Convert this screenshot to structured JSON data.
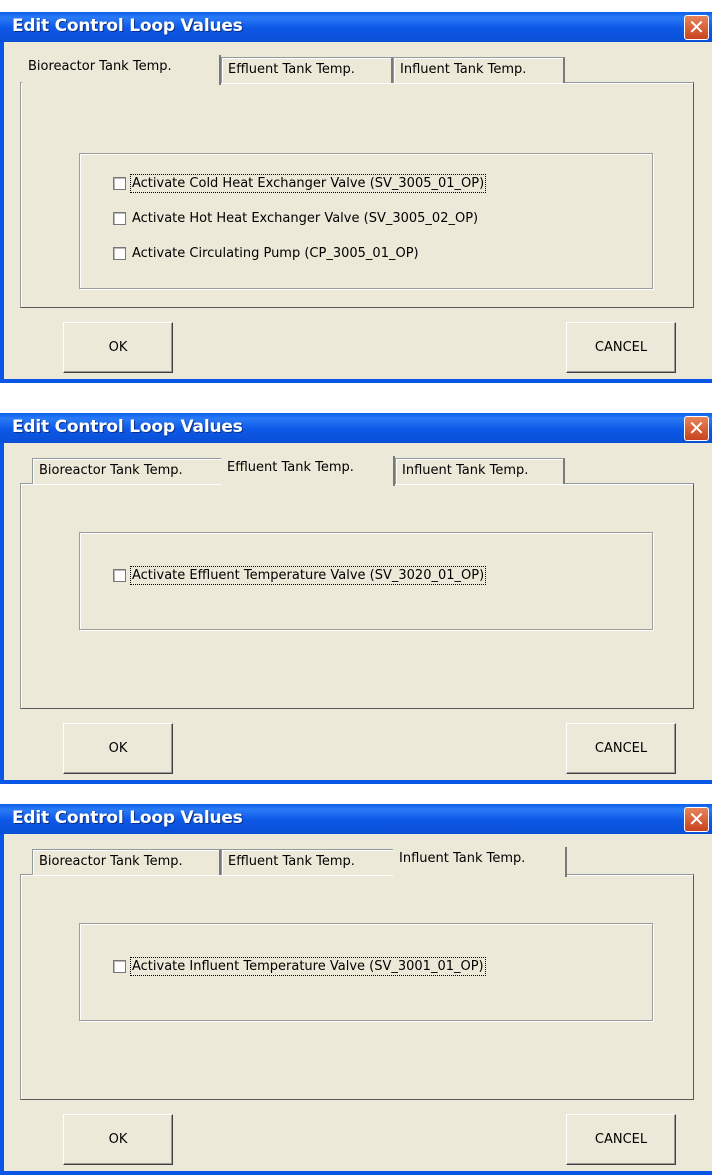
{
  "dialogs": [
    {
      "title": "Edit Control Loop Values",
      "close_glyph": "✕",
      "tabs": [
        "Bioreactor Tank Temp.",
        "Effluent Tank Temp.",
        "Influent Tank Temp."
      ],
      "active_tab": 0,
      "checkboxes": [
        {
          "label": "Activate Cold Heat Exchanger Valve (SV_3005_01_OP)",
          "checked": false
        },
        {
          "label": "Activate Hot Heat Exchanger Valve (SV_3005_02_OP)",
          "checked": false
        },
        {
          "label": "Activate Circulating Pump (CP_3005_01_OP)",
          "checked": false
        }
      ],
      "ok_label": "OK",
      "cancel_label": "CANCEL"
    },
    {
      "title": "Edit Control Loop Values",
      "close_glyph": "✕",
      "tabs": [
        "Bioreactor Tank Temp.",
        "Effluent Tank Temp.",
        "Influent Tank Temp."
      ],
      "active_tab": 1,
      "checkboxes": [
        {
          "label": "Activate Effluent Temperature Valve (SV_3020_01_OP)",
          "checked": false
        }
      ],
      "ok_label": "OK",
      "cancel_label": "CANCEL"
    },
    {
      "title": "Edit Control Loop Values",
      "close_glyph": "✕",
      "tabs": [
        "Bioreactor Tank Temp.",
        "Effluent Tank Temp.",
        "Influent Tank Temp."
      ],
      "active_tab": 2,
      "checkboxes": [
        {
          "label": "Activate Influent Temperature Valve (SV_3001_01_OP)",
          "checked": false
        }
      ],
      "ok_label": "OK",
      "cancel_label": "CANCEL"
    }
  ]
}
